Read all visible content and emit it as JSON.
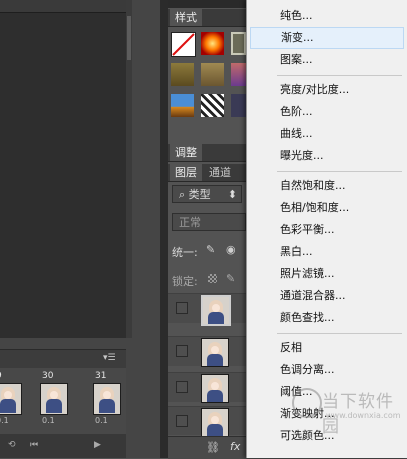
{
  "left": {
    "frames": [
      {
        "num": "9",
        "delay": "0.1"
      },
      {
        "num": "30",
        "delay": "0.1"
      },
      {
        "num": "31",
        "delay": "0.1"
      }
    ],
    "panel_menu_icon": "panel-menu-icon"
  },
  "dock": {
    "styles_tab": "样式",
    "adjust_tab": "调整",
    "layers_tab": "图层",
    "channels_tab": "通道",
    "kind_filter": "类型",
    "blend_mode": "正常",
    "unify_label": "统一:",
    "lock_label": "锁定:",
    "fx_label": "fx"
  },
  "menu": {
    "groups": [
      [
        "纯色...",
        "渐变...",
        "图案..."
      ],
      [
        "亮度/对比度...",
        "色阶...",
        "曲线...",
        "曝光度..."
      ],
      [
        "自然饱和度...",
        "色相/饱和度...",
        "色彩平衡...",
        "黑白...",
        "照片滤镜...",
        "通道混合器...",
        "颜色查找..."
      ],
      [
        "反相",
        "色调分离...",
        "阈值...",
        "渐变映射...",
        "可选颜色..."
      ]
    ],
    "hover_index": 1
  },
  "watermark": {
    "text": "当下软件园",
    "url": "www.downxia.com"
  },
  "colors": {
    "menu_bg": "#f0f0f0",
    "menu_hover": "#e5f0fb",
    "dock_bg": "#535353",
    "canvas_bg": "#2e2e2e"
  }
}
